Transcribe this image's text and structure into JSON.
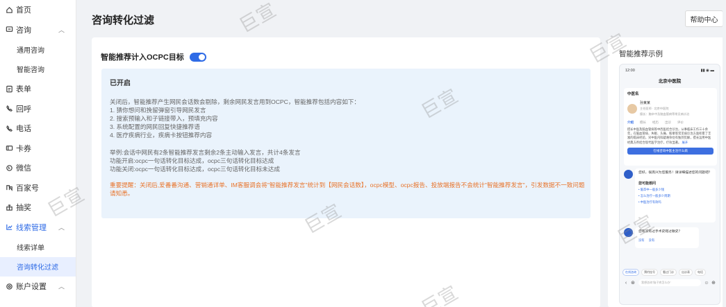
{
  "sidebar": {
    "items": [
      {
        "label": "首页",
        "icon": "home-icon",
        "type": "top"
      },
      {
        "label": "咨询",
        "icon": "chat-box-icon",
        "type": "group",
        "expanded": true
      },
      {
        "label": "通用咨询",
        "type": "sub"
      },
      {
        "label": "智能咨询",
        "type": "sub"
      },
      {
        "label": "表单",
        "icon": "form-icon",
        "type": "top"
      },
      {
        "label": "回呼",
        "icon": "callback-icon",
        "type": "top"
      },
      {
        "label": "电话",
        "icon": "phone-icon",
        "type": "top"
      },
      {
        "label": "卡券",
        "icon": "card-icon",
        "type": "top"
      },
      {
        "label": "微信",
        "icon": "wechat-icon",
        "type": "top"
      },
      {
        "label": "百家号",
        "icon": "baijiahao-icon",
        "type": "top"
      },
      {
        "label": "抽奖",
        "icon": "gift-icon",
        "type": "top"
      },
      {
        "label": "线索管理",
        "icon": "chart-icon",
        "type": "group",
        "expanded": true
      },
      {
        "label": "线索详单",
        "type": "sub"
      },
      {
        "label": "咨询转化过滤",
        "type": "sub",
        "active": true
      },
      {
        "label": "账户设置",
        "icon": "settings-icon",
        "type": "group",
        "expanded": true
      }
    ]
  },
  "header": {
    "title": "咨询转化过滤",
    "help_label": "帮助中心"
  },
  "settings": {
    "toggle_label": "智能推荐计入OCPC目标",
    "toggle_on": true
  },
  "info": {
    "title": "已开启",
    "lines": [
      "关闭后，智能推荐产生网民会话数会剔除，剩余网民发言用到OCPC，智能推荐包括内容如下：",
      "1. 猜你想问和挽留弹窗引导网民发言",
      "2. 搜索预输入和子链接带入，预填充内容",
      "3. 系统配置的网民回复快捷推荐语",
      "4. 医疗疾病行业，疾病卡按钮推荐内容"
    ],
    "example_lines": [
      "举例:会话中网民有2条智能推荐发言剩余2条主动输入发言，共计4条发言",
      "功能开启:ocpc一句话转化目标达成，ocpc三句话转化目标达成",
      "功能关闭:ocpc一句话转化目标达成，ocpc三句话转化目标未达成"
    ],
    "warning": "重要提醒：关闭后,爱番番沟通、营销通详单、IM客服调会将\"智能推荐发言\"统计到【网民会话数】，ocpc模型、ocpc报告、投放端报告不会统计\"智能推荐发言\"，引发数据不一致问题请知悉。",
    "warning_color": "#e8732a",
    "bg_color": "#eaf3fc"
  },
  "example": {
    "title": "智能推荐示例",
    "phone": {
      "time": "12:00",
      "signal": "▮▮ ◉ ▬",
      "hospital": "北京中医院",
      "card_title": "中医名",
      "doctor_name": "孙某某",
      "doctor_meta": "主任医师 · 北京中医院",
      "doctor_desc": "擅长：脑卒中及脑血管病等常见病诊治",
      "tabs": [
        "介绍",
        "擅长",
        "经历",
        "出诊",
        "评价"
      ],
      "paragraph": "擅长中医及脑血管病等中西医结合诊治，从事临床工作三十余年，在脑血管病、失眠、头痛、眩晕等常见病诊治方面积累了丰富的临床经验，对中医内科疑难杂症有独到见解，擅长运用中医经典方剂结合现代医学治疗，疗效显著。",
      "more_label": "展开",
      "cta": "在线咨询中医主治什么病",
      "bubble_text": "您好，很高兴为您服务！请详细描述您的问题吧？",
      "bubble_head": "您可能想问",
      "bubble_items": [
        "• 脑卒中一般多少钱",
        "• 怎么治疗一般多少周期",
        "• 中医治疗有效吗"
      ],
      "bubble2_text": "您有没有过手术史呢过敏史？",
      "bubble2_opts": [
        "没有",
        "没有"
      ],
      "chips": [
        "在线咨询",
        "预约挂号",
        "看过门诊",
        "出诊表",
        "电话"
      ],
      "input_placeholder": "我想咨询\"脑子疼怎么办\""
    }
  },
  "watermarks": [
    "巨宣",
    "巨宣",
    "巨宣",
    "巨宣",
    "巨宣",
    "巨宣",
    "巨宣"
  ],
  "colors": {
    "accent": "#2f6be6",
    "active_bg": "#e8efff"
  }
}
